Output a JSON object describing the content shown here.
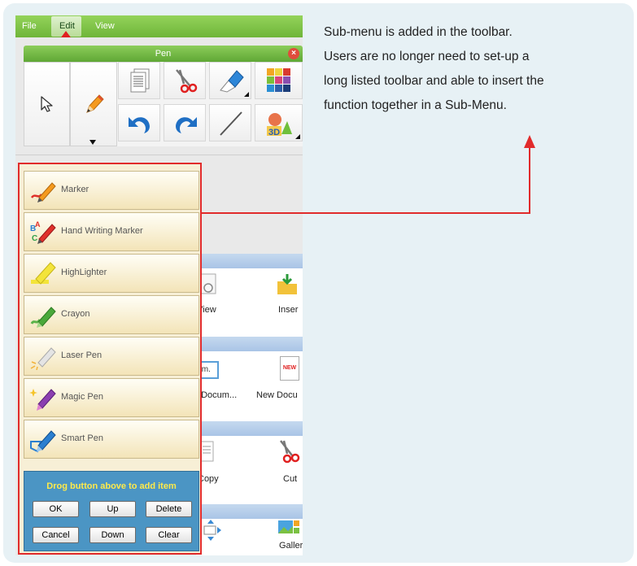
{
  "menu": {
    "items": [
      "File",
      "Edit",
      "View"
    ]
  },
  "pen_toolbar": {
    "title": "Pen",
    "close_glyph": "×"
  },
  "submenu": {
    "items": [
      {
        "label": "Marker",
        "icon": "marker-icon"
      },
      {
        "label": "Hand Writing Marker",
        "icon": "handwriting-marker-icon"
      },
      {
        "label": "HighLighter",
        "icon": "highlighter-icon"
      },
      {
        "label": "Crayon",
        "icon": "crayon-icon"
      },
      {
        "label": "Laser Pen",
        "icon": "laser-pen-icon"
      },
      {
        "label": "Magic Pen",
        "icon": "magic-pen-icon"
      },
      {
        "label": "Smart Pen",
        "icon": "smart-pen-icon"
      }
    ],
    "drop_hint": "Drog button above to add item",
    "buttons": {
      "ok": "OK",
      "up": "Up",
      "delete": "Delete",
      "cancel": "Cancel",
      "down": "Down",
      "clear": "Clear"
    }
  },
  "background_labels": {
    "view": "View",
    "insert": "Inser",
    "import_doc": "t Docum...",
    "new_doc": "New Docu",
    "copy": "Copy",
    "cut": "Cut",
    "gallery": "Galler",
    "new_badge": "NEW",
    "im_badge": "Im."
  },
  "description": {
    "lines": [
      "Sub-menu is added in the toolbar.",
      "Users are no longer need to set-up a",
      "long listed toolbar and able to insert the",
      "function together in a Sub-Menu."
    ]
  },
  "colors": {
    "accent_red": "#e12b2b",
    "menu_green": "#7cc245",
    "panel_blue": "#4b95c4",
    "hint_yellow": "#ffea4a"
  }
}
